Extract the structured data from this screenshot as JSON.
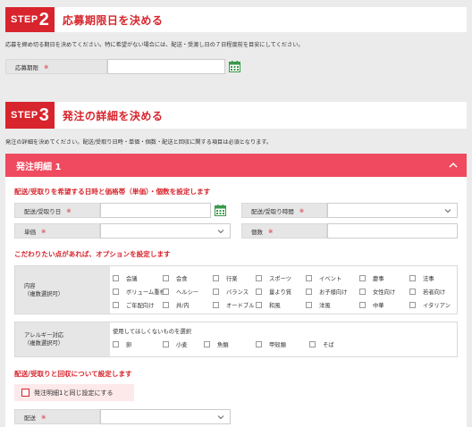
{
  "step2": {
    "word": "STEP",
    "num": "2",
    "title": "応募期限日を決める",
    "desc": "応募を締め切る期日を決めてください。特に希望がない場合には、配送・受渡し日の７日程度前を目安にしてください。",
    "deadline_label": "応募期限",
    "required_mark": "※"
  },
  "step3": {
    "word": "STEP",
    "num": "3",
    "title": "発注の詳細を決める",
    "desc": "発注の詳細を決めてください。配送/受取り日時・単価・個数・配送と回収に関する項目は必須となります。"
  },
  "order": {
    "title": "発注明細 1",
    "section1": "配送/受取りを希望する日時と価格帯（単価）・個数を設定します",
    "date_label": "配送/受取り日",
    "time_label": "配送/受取り時間",
    "price_label": "単価",
    "qty_label": "個数",
    "required_mark": "※",
    "section2": "こだわりたい点があれば、オプションを設定します",
    "content_label": "内容",
    "content_sub": "（複数選択可）",
    "content_options": [
      "会議",
      "会食",
      "行楽",
      "スポーツ",
      "イベント",
      "慶事",
      "法事",
      "ボリューム重視",
      "ヘルシー",
      "バランス",
      "量より質",
      "お子様向け",
      "女性向け",
      "若者向け",
      "ご年配向け",
      "并/内",
      "オードブル",
      "和風",
      "洋風",
      "中華",
      "イタリアン"
    ],
    "allergy_label": "アレルギー対応",
    "allergy_sub": "（複数選択可）",
    "allergy_note": "使用してほしくないものを選択",
    "allergy_options": [
      "卵",
      "小麦",
      "魚類",
      "甲殻類",
      "そば"
    ],
    "section3": "配送/受取りと回収について設定します",
    "same_as_label": "発注明細1と同じ設定にする",
    "delivery_label": "配送"
  },
  "colors": {
    "accent": "#d8242c",
    "panel_head": "#ef4a5f",
    "calendar": "#3a9a4a"
  },
  "icons": {
    "calendar": "calendar-icon",
    "chevron": "chevron-down-icon",
    "collapse": "chevron-up-icon"
  }
}
